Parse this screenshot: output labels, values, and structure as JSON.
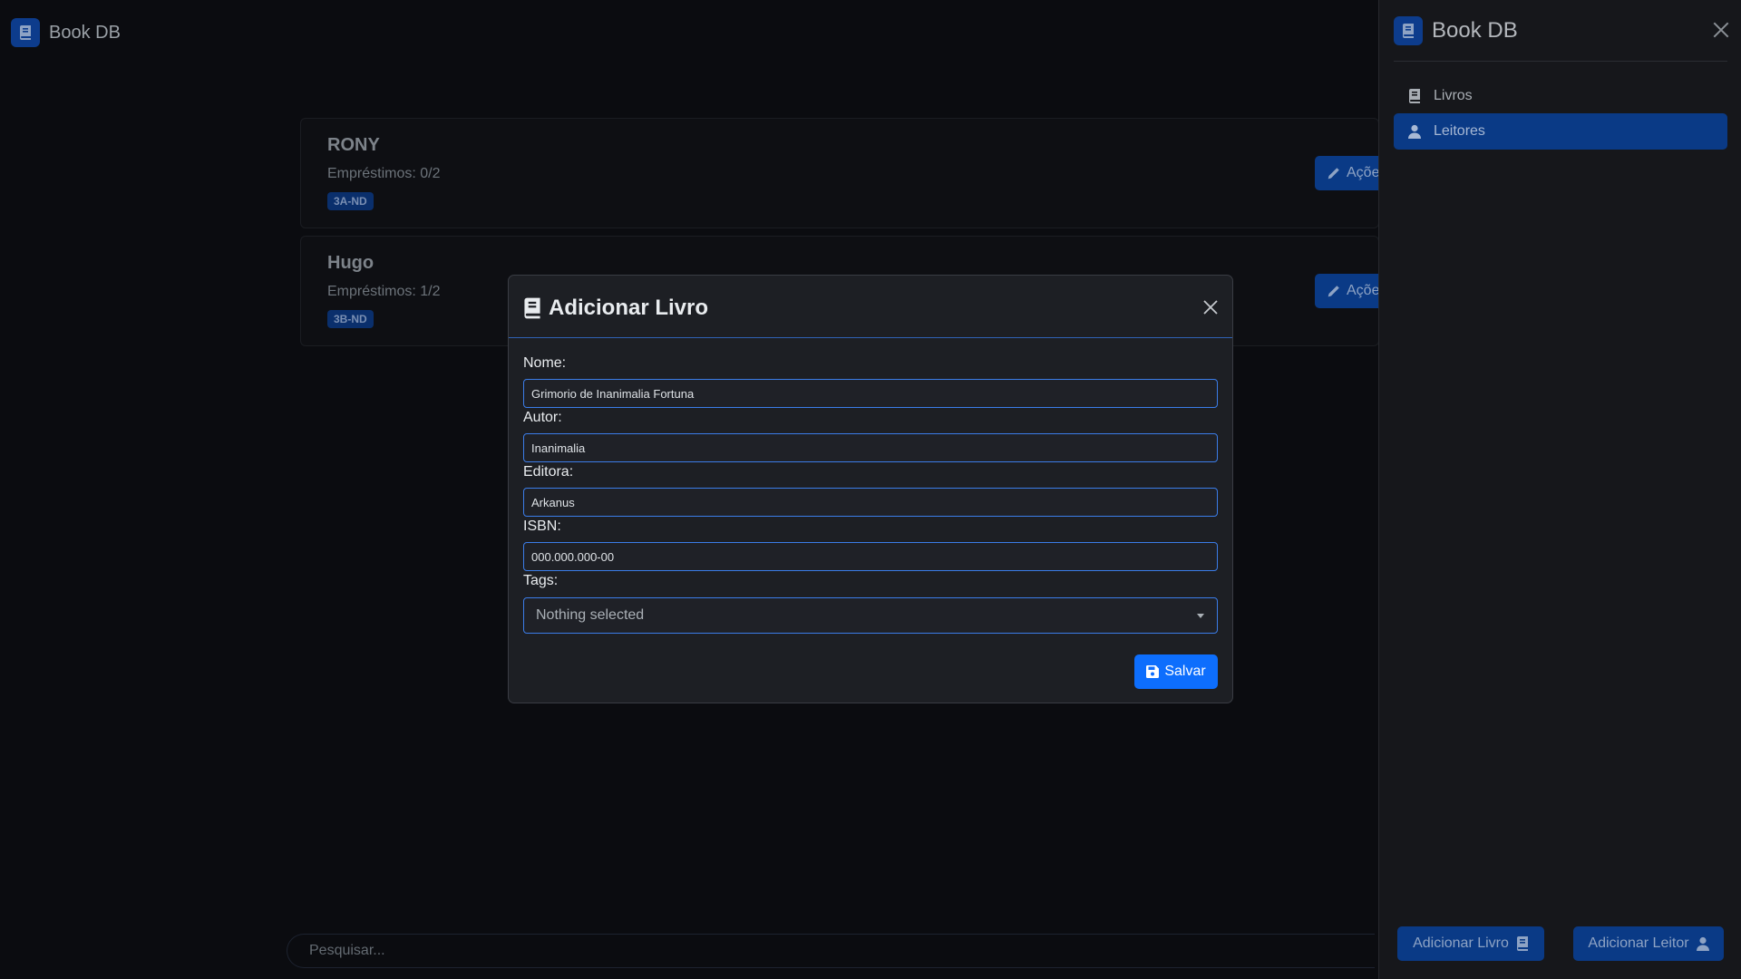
{
  "app": {
    "title": "Book DB"
  },
  "readers": [
    {
      "name": "RONY",
      "loans": "Empréstimos: 0/2",
      "badge": "3A-ND",
      "action_label": "Açõe"
    },
    {
      "name": "Hugo",
      "loans": "Empréstimos: 1/2",
      "badge": "3B-ND",
      "action_label": "Açõe"
    }
  ],
  "search": {
    "placeholder": "Pesquisar..."
  },
  "sidebar": {
    "title": "Book DB",
    "items": [
      {
        "label": "Livros",
        "icon": "book-icon",
        "active": false
      },
      {
        "label": "Leitores",
        "icon": "user-icon",
        "active": true
      }
    ],
    "buttons": {
      "add_book": "Adicionar Livro",
      "add_reader": "Adicionar Leitor"
    }
  },
  "modal": {
    "title": "Adicionar Livro",
    "fields": {
      "nome": {
        "label": "Nome:",
        "value": "Grimorio de Inanimalia Fortuna"
      },
      "autor": {
        "label": "Autor:",
        "value": "Inanimalia"
      },
      "editora": {
        "label": "Editora:",
        "value": "Arkanus"
      },
      "isbn": {
        "label": "ISBN:",
        "value": "000.000.000-00"
      },
      "tags": {
        "label": "Tags:",
        "value": "Nothing selected"
      }
    },
    "save_label": "Salvar"
  },
  "colors": {
    "accent": "#0d6efd",
    "dim_accent": "#0a3a86",
    "input_border": "#3b7de9",
    "background": "#0b0c10",
    "modal_bg": "#1d1f24",
    "sidebar_bg": "#16171b"
  }
}
